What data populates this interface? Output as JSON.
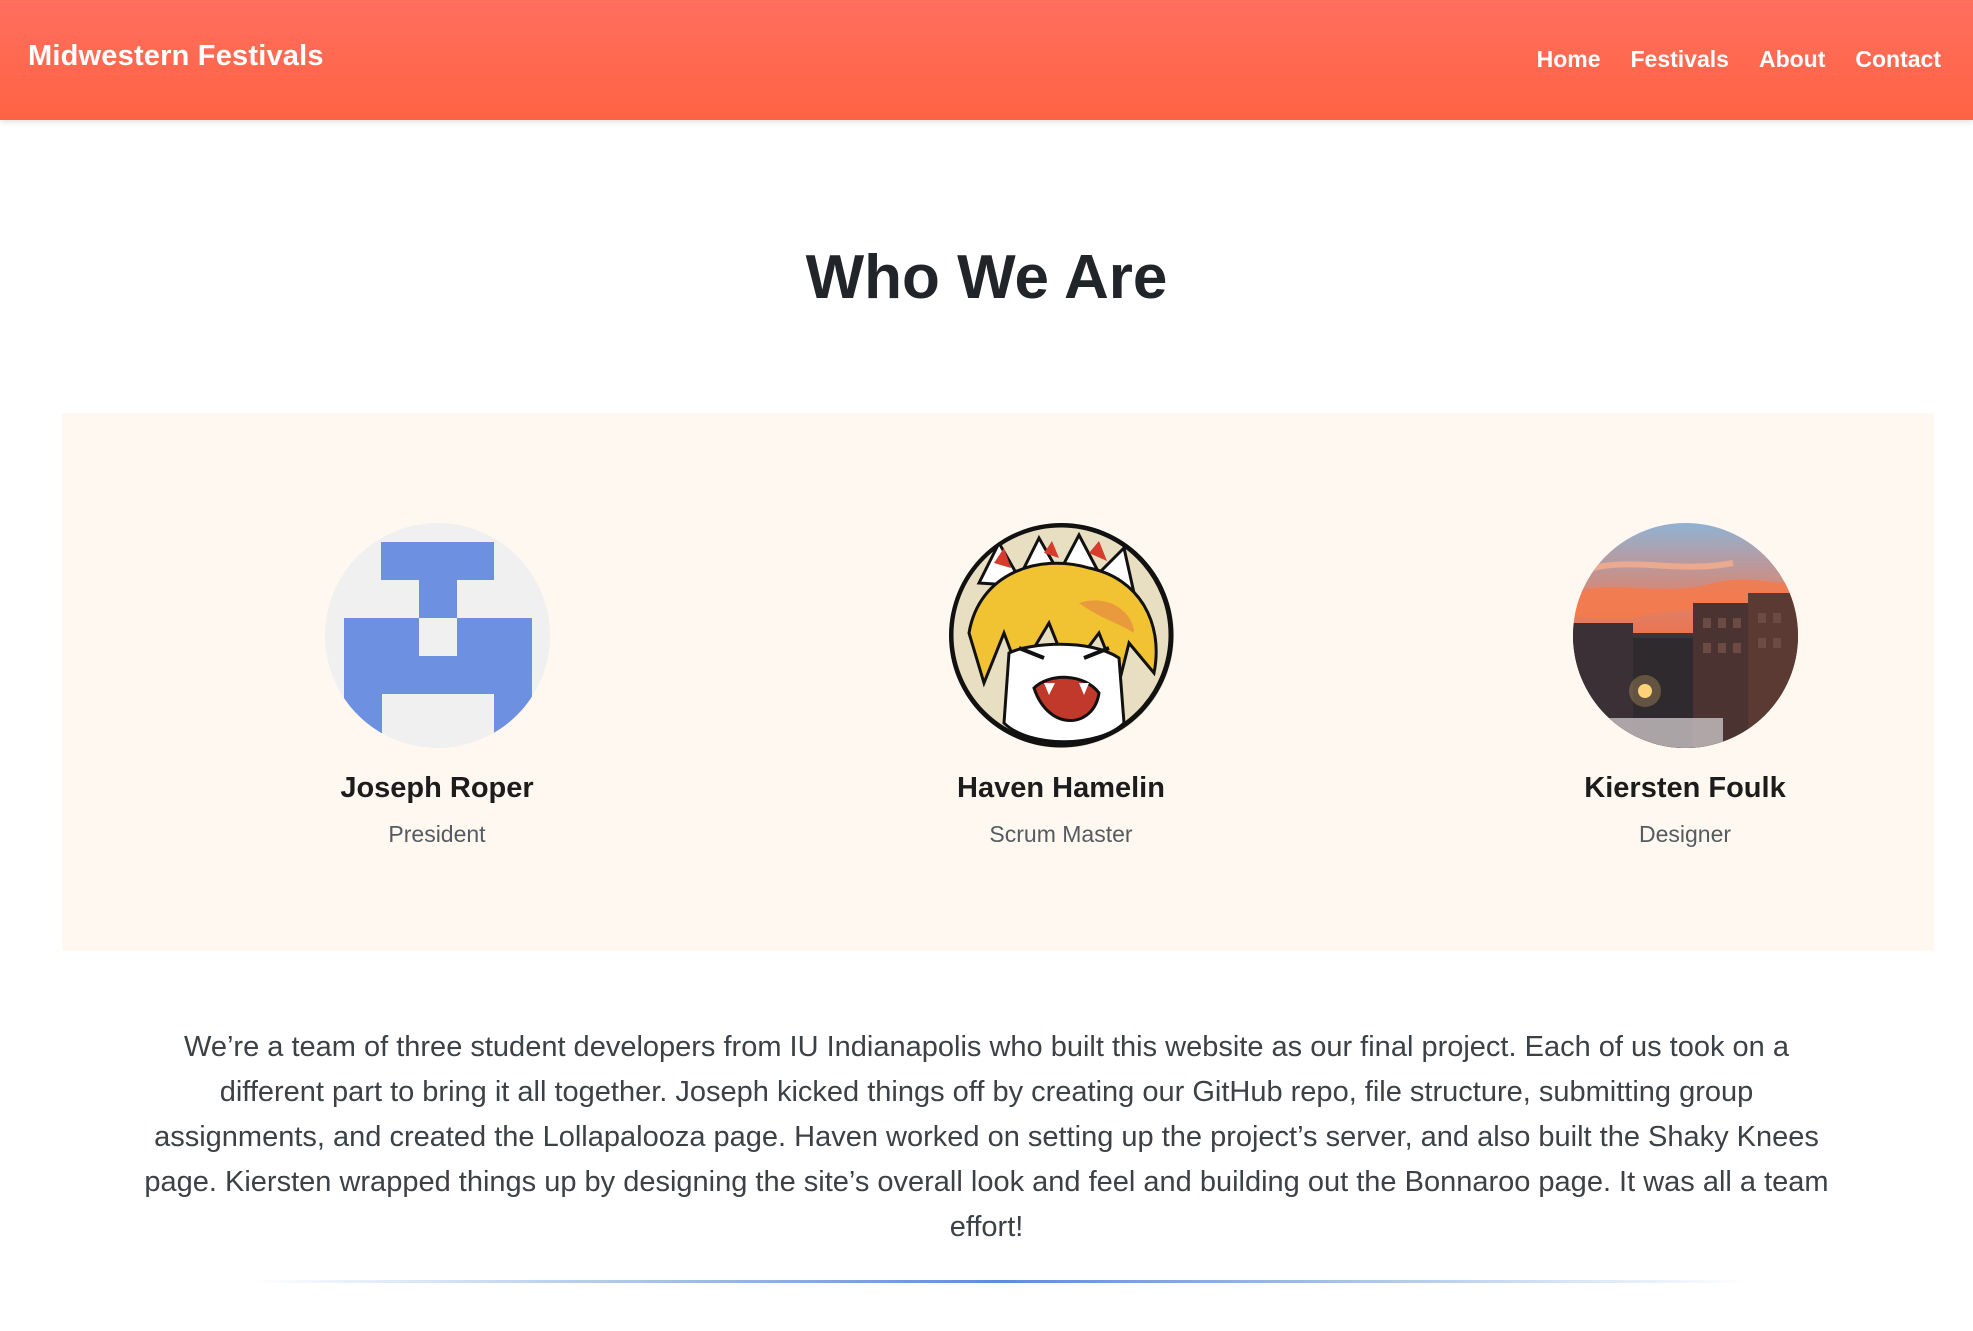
{
  "navbar": {
    "brand": "Midwestern Festivals",
    "links": [
      {
        "label": "Home"
      },
      {
        "label": "Festivals"
      },
      {
        "label": "About"
      },
      {
        "label": "Contact"
      }
    ],
    "color": "#ff6550"
  },
  "page": {
    "title": "Who We Are"
  },
  "team": {
    "panel_color": "#fff8f1",
    "members": [
      {
        "name": "Joseph Roper",
        "role": "President",
        "avatar": "pixel-identicon-avatar"
      },
      {
        "name": "Haven Hamelin",
        "role": "Scrum Master",
        "avatar": "anime-character-avatar"
      },
      {
        "name": "Kiersten Foulk",
        "role": "Designer",
        "avatar": "sunset-cityscape-photo"
      }
    ]
  },
  "about": {
    "text": "We’re a team of three student developers from IU Indianapolis who built this website as our final project. Each of us took on a different part to bring it all together. Joseph kicked things off by creating our GitHub repo, file structure, submitting group assignments, and created the Lollapalooza page. Haven worked on setting up the project’s server, and also built the Shaky Knees page. Kiersten wrapped things up by designing the site’s overall look and feel and building out the Bonnaroo page. It was all a team effort!"
  }
}
